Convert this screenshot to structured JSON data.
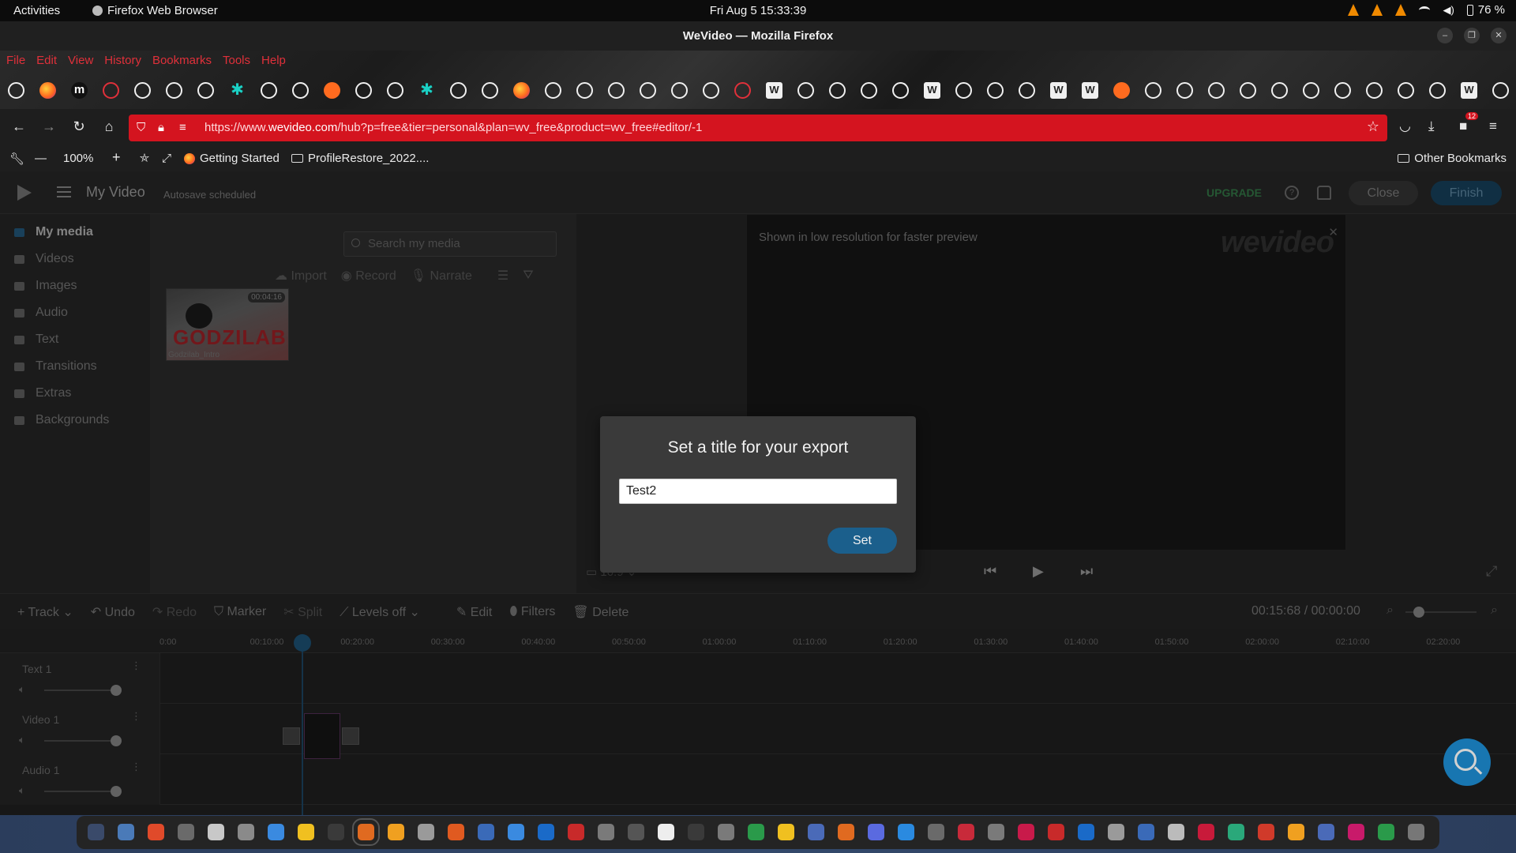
{
  "system_bar": {
    "activities": "Activities",
    "app_name": "Firefox Web Browser",
    "clock": "Fri Aug 5  15:33:39",
    "battery": "76 %"
  },
  "window": {
    "title": "WeVideo — Mozilla Firefox"
  },
  "menu": [
    "File",
    "Edit",
    "View",
    "History",
    "Bookmarks",
    "Tools",
    "Help"
  ],
  "bookmark_icons": [
    "github",
    "firefox",
    "m",
    "cog",
    "github",
    "github",
    "github",
    "star",
    "github",
    "github",
    "orange",
    "github",
    "github",
    "star",
    "github",
    "github",
    "firefox",
    "github",
    "github",
    "github",
    "github",
    "github",
    "github",
    "globe",
    "w",
    "github",
    "github",
    "github",
    "github",
    "w",
    "github",
    "github",
    "github",
    "w",
    "w",
    "orange",
    "github",
    "github",
    "github",
    "github",
    "github",
    "github",
    "github",
    "github",
    "github",
    "github",
    "w",
    "github"
  ],
  "navbar": {
    "url_prefix": "https://www.",
    "url_domain": "wevideo.com",
    "url_rest": "/hub?p=free&tier=personal&plan=wv_free&product=wv_free#editor/-1",
    "extension_badge": "12"
  },
  "bookmarks_toolbar": {
    "zoom": "100%",
    "getting_started": "Getting Started",
    "profile_restore": "ProfileRestore_2022....",
    "other": "Other Bookmarks"
  },
  "app_header": {
    "project_title": "My Video",
    "autosave": "Autosave scheduled",
    "upgrade": "UPGRADE",
    "close": "Close",
    "finish": "Finish"
  },
  "sidebar": {
    "items": [
      {
        "label": "My media"
      },
      {
        "label": "Videos"
      },
      {
        "label": "Images"
      },
      {
        "label": "Audio"
      },
      {
        "label": "Text"
      },
      {
        "label": "Transitions"
      },
      {
        "label": "Extras"
      },
      {
        "label": "Backgrounds"
      }
    ]
  },
  "media": {
    "search_placeholder": "Search my media",
    "import": "Import",
    "record": "Record",
    "narrate": "Narrate",
    "thumb_title": "GODZILAB",
    "thumb_duration": "00:04:16",
    "thumb_name": "Godzilab_Intro"
  },
  "preview": {
    "message": "Shown in low resolution for faster preview",
    "watermark": "wevideo",
    "aspect": "16:9"
  },
  "timeline": {
    "tools": {
      "track": "Track",
      "undo": "Undo",
      "redo": "Redo",
      "marker": "Marker",
      "split": "Split",
      "levels": "Levels off",
      "edit": "Edit",
      "filters": "Filters",
      "delete": "Delete"
    },
    "timecode": "00:15:68 / 00:00:00",
    "ticks": [
      "0:00",
      "00:10:00",
      "00:20:00",
      "00:30:00",
      "00:40:00",
      "00:50:00",
      "01:00:00",
      "01:10:00",
      "01:20:00",
      "01:30:00",
      "01:40:00",
      "01:50:00",
      "02:00:00",
      "02:10:00",
      "02:20:00",
      "02:3"
    ],
    "tracks": [
      {
        "name": "Text 1"
      },
      {
        "name": "Video 1"
      },
      {
        "name": "Audio 1"
      }
    ]
  },
  "modal": {
    "title": "Set a title for your export",
    "value": "Test2",
    "button": "Set"
  },
  "dock_colors": [
    "#3a4a6a",
    "#4a7ab8",
    "#e04a2a",
    "#6a6a6a",
    "#c8c8c8",
    "#8a8a8a",
    "#3a8ae0",
    "#f0c020",
    "#3a3a3a",
    "#e06a20",
    "#f0a020",
    "#9a9a9a",
    "#e05a20",
    "#3a6ab8",
    "#3a8ae0",
    "#1a6ac8",
    "#c82a2a",
    "#7a7a7a",
    "#555",
    "#eee",
    "#3a3a3a",
    "#7a7a7a",
    "#2a9a4a",
    "#f0c020",
    "#4a6ab8",
    "#e06a20",
    "#5a6ae0",
    "#2a8ae0",
    "#6a6a6a",
    "#c82a3a",
    "#7a7a7a",
    "#c81a4a",
    "#c82a2a",
    "#1a6ac8",
    "#9a9a9a",
    "#3a6ab8",
    "#bbb",
    "#c81a3a",
    "#2aa87a",
    "#d03a2a",
    "#f0a020",
    "#4a6ab8",
    "#c81a6a",
    "#2a9a4a",
    "#777"
  ],
  "dock_active_index": 9
}
